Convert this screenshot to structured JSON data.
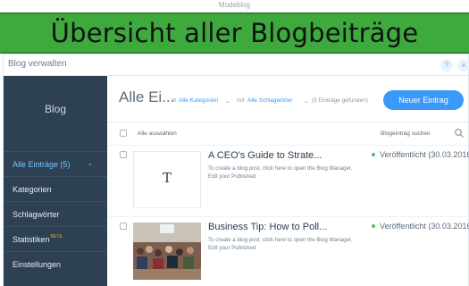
{
  "top_strip": {
    "text": "Modeblog"
  },
  "banner": {
    "title": "Übersicht aller Blogbeiträge"
  },
  "dialog": {
    "title": "Blog verwalten",
    "help_label": "?",
    "close_label": "×"
  },
  "sidebar": {
    "title": "Blog",
    "items": [
      {
        "label": "Alle Einträge (5)",
        "chevron": "⌄",
        "active": true
      },
      {
        "label": "Kategorien"
      },
      {
        "label": "Schlagwörter"
      },
      {
        "label": "Statistiken",
        "badge": "BETA"
      },
      {
        "label": "Einstellungen"
      }
    ]
  },
  "main": {
    "title": "Alle Ei...",
    "filter": {
      "prefix_in": "In",
      "category": "Alle Kategorien",
      "prefix_with": "mit",
      "tags": "Alle Schlagwörter",
      "found": "(5 Einträge gefunden)"
    },
    "new_button": "Neuer Eintrag",
    "select_all": "Alle auswählen",
    "search_label": "Blogeintrag suchen",
    "posts": [
      {
        "title": "A CEO's Guide to Strate...",
        "description": "To create a blog post, click here to open the Blog Manager.  Edit your Published",
        "status": "Veröffentlicht",
        "date": "(30.03.2016",
        "thumb_letter": "T"
      },
      {
        "title": "Business Tip: How to Poll...",
        "description": "To create a blog post, click here to open the Blog Manager.  Edit your Published",
        "status": "Veröffentlicht",
        "date": "(30.03.2016"
      }
    ]
  },
  "colors": {
    "banner": "#3eaa3e",
    "sidebar": "#2e4152",
    "accent": "#3b99fc",
    "status_green": "#49c85b"
  }
}
